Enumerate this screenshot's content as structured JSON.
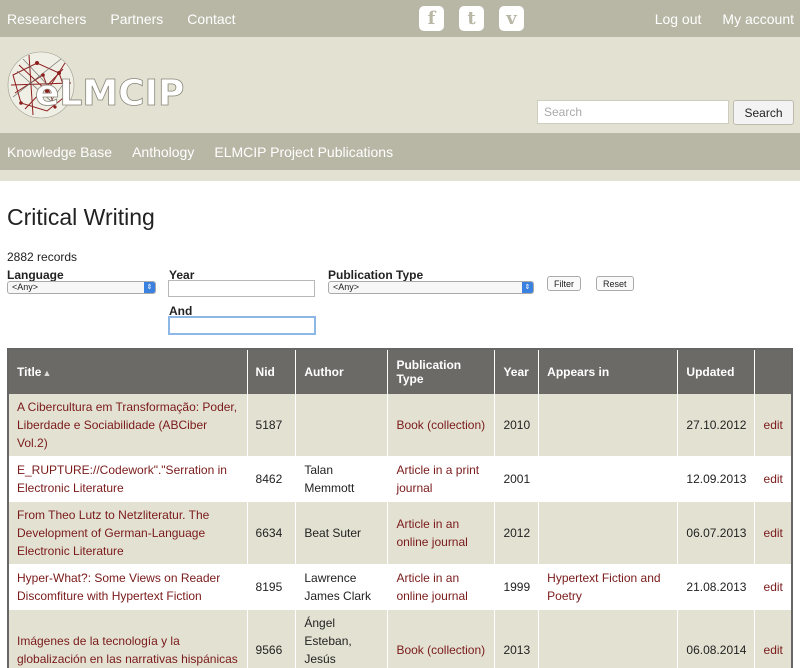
{
  "topnav": {
    "left": [
      "Researchers",
      "Partners",
      "Contact"
    ],
    "right": [
      "Log out",
      "My account"
    ],
    "social": [
      {
        "icon": "facebook-icon",
        "glyph": "f"
      },
      {
        "icon": "twitter-icon",
        "glyph": "t"
      },
      {
        "icon": "vimeo-icon",
        "glyph": "v"
      }
    ]
  },
  "brand": {
    "logo_text": "eLMCIP",
    "search_placeholder": "Search",
    "search_button": "Search"
  },
  "mainnav": [
    "Knowledge Base",
    "Anthology",
    "ELMCIP Project Publications"
  ],
  "page": {
    "title": "Critical Writing",
    "record_count": "2882 records"
  },
  "filters": {
    "language_label": "Language",
    "language_value": "<Any>",
    "year_label": "Year",
    "and_label": "And",
    "pubtype_label": "Publication Type",
    "pubtype_value": "<Any>",
    "filter_button": "Filter",
    "reset_button": "Reset"
  },
  "table": {
    "headers": {
      "title": "Title",
      "nid": "Nid",
      "author": "Author",
      "pubtype": "Publication Type",
      "year": "Year",
      "appears": "Appears in",
      "updated": "Updated",
      "edit": ""
    },
    "rows": [
      {
        "title": "A Cibercultura em Transformação: Poder, Liberdade e Sociabilidade (ABCiber Vol.2)",
        "nid": "5187",
        "author": "",
        "pubtype": "Book (collection)",
        "year": "2010",
        "appears": "",
        "updated": "27.10.2012",
        "edit": "edit"
      },
      {
        "title": "E_RUPTURE://Codework\".\"Serration in Electronic Literature",
        "nid": "8462",
        "author": "Talan Memmott",
        "pubtype": "Article in a print journal",
        "year": "2001",
        "appears": "",
        "updated": "12.09.2013",
        "edit": "edit"
      },
      {
        "title": "From Theo Lutz to Netzliteratur. The Development of German-Language Electronic Literature",
        "nid": "6634",
        "author": "Beat Suter",
        "pubtype": "Article in an online journal",
        "year": "2012",
        "appears": "",
        "updated": "06.07.2013",
        "edit": "edit"
      },
      {
        "title": "Hyper-What?: Some Views on Reader Discomfiture with Hypertext Fiction",
        "nid": "8195",
        "author": "Lawrence James Clark",
        "pubtype": "Article in an online journal",
        "year": "1999",
        "appears": "Hypertext Fiction and Poetry",
        "updated": "21.08.2013",
        "edit": "edit"
      },
      {
        "title": "Imágenes de la tecnología y la globalización en las narrativas hispánicas",
        "nid": "9566",
        "author": "Ángel Esteban, Jesús Montoya",
        "pubtype": "Book (collection)",
        "year": "2013",
        "appears": "",
        "updated": "06.08.2014",
        "edit": "edit"
      }
    ]
  }
}
